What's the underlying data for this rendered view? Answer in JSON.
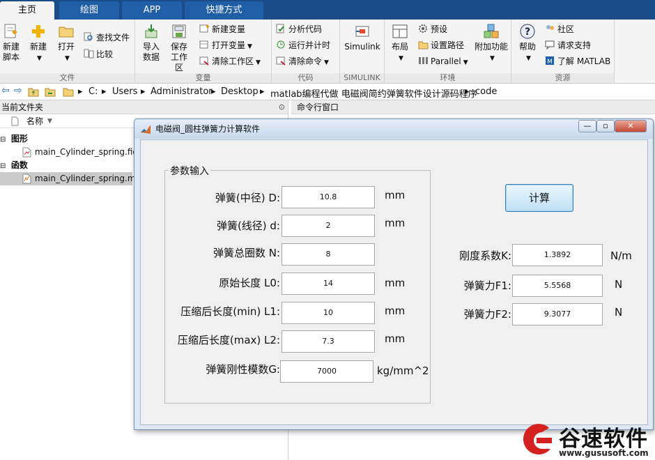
{
  "tabs": [
    {
      "label": "主页"
    },
    {
      "label": "绘图"
    },
    {
      "label": "APP"
    },
    {
      "label": "快捷方式"
    }
  ],
  "toolstrip": {
    "file": {
      "group_label": "文件",
      "new_script": "新建\n脚本",
      "new": "新建",
      "open": "打开",
      "find_files": "查找文件",
      "compare": "比较"
    },
    "variable": {
      "group_label": "变量",
      "import_data": "导入\n数据",
      "save_workspace": "保存\n工作区",
      "new_variable": "新建变量",
      "open_variable": "打开变量",
      "clear_workspace": "清除工作区"
    },
    "code": {
      "group_label": "代码",
      "analyze_code": "分析代码",
      "run_and_time": "运行并计时",
      "clear_commands": "清除命令"
    },
    "simulink": {
      "group_label": "SIMULINK",
      "simulink": "Simulink"
    },
    "environment": {
      "group_label": "环境",
      "layout": "布局",
      "preferences": "预设",
      "set_path": "设置路径",
      "parallel": "Parallel",
      "addons": "附加功能"
    },
    "resources": {
      "group_label": "资源",
      "help": "帮助",
      "community": "社区",
      "request_support": "请求支持",
      "learn_matlab": "了解 MATLAB"
    }
  },
  "address": {
    "crumbs": [
      "C:",
      "Users",
      "Administrator",
      "Desktop",
      "matlab编程代做 电磁阀简约弹簧软件设计源码程序",
      "code"
    ]
  },
  "file_browser": {
    "title": "当前文件夹",
    "column_name": "名称",
    "groups": [
      {
        "label": "图形",
        "items": [
          {
            "name": "main_Cylinder_spring.fig"
          }
        ]
      },
      {
        "label": "函数",
        "items": [
          {
            "name": "main_Cylinder_spring.m"
          }
        ]
      }
    ]
  },
  "command_window": {
    "title": "命令行窗口"
  },
  "dialog": {
    "title": "电磁阀_圆柱弹簧力计算软件",
    "input_group_label": "参数输入",
    "fields": [
      {
        "label": "弹簧(中径) D:",
        "value": "10.8",
        "unit": "mm"
      },
      {
        "label": "弹簧(线径) d:",
        "value": "2",
        "unit": "mm"
      },
      {
        "label": "弹簧总圈数 N:",
        "value": "8",
        "unit": ""
      },
      {
        "label": "原始长度 L0:",
        "value": "14",
        "unit": "mm"
      },
      {
        "label": "压缩后长度(min) L1:",
        "value": "10",
        "unit": "mm"
      },
      {
        "label": "压缩后长度(max) L2:",
        "value": "7.3",
        "unit": "mm"
      },
      {
        "label": "弹簧刚性模数G:",
        "value": "7000",
        "unit": "kg/mm^2"
      }
    ],
    "calc_button": "计算",
    "outputs": [
      {
        "label": "刚度系数K:",
        "value": "1.3892",
        "unit": "N/m"
      },
      {
        "label": "弹簧力F1:",
        "value": "5.5568",
        "unit": "N"
      },
      {
        "label": "弹簧力F2:",
        "value": "9.3077",
        "unit": "N"
      }
    ]
  },
  "watermark": {
    "text": "谷速软件",
    "url": "www.gususoft.com"
  }
}
